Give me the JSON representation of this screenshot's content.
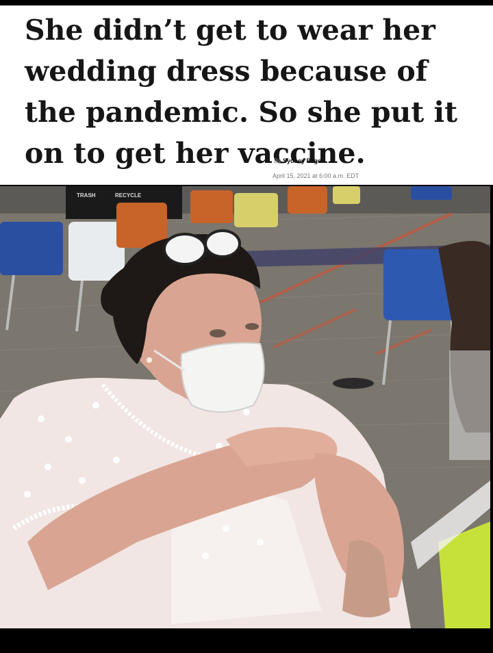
{
  "article": {
    "headline": "She didn’t get to wear her wedding dress because of the pandemic. So she put it on to get her vaccine.",
    "byline_prefix": "By",
    "author": "Sydney Page",
    "date": "April 15, 2021 at 6:00 a.m. EDT"
  },
  "photo": {
    "sign_text": "TRASH",
    "sign_text_2": "RECYCLE"
  },
  "colors": {
    "background": "#000000",
    "header_bg": "#ffffff",
    "headline_text": "#161616",
    "carpet": "#7b766e",
    "chair_blue": "#2e59b0",
    "chair_orange": "#c8632a",
    "dress": "#f1e6e4",
    "mask": "#f4f4f2"
  }
}
